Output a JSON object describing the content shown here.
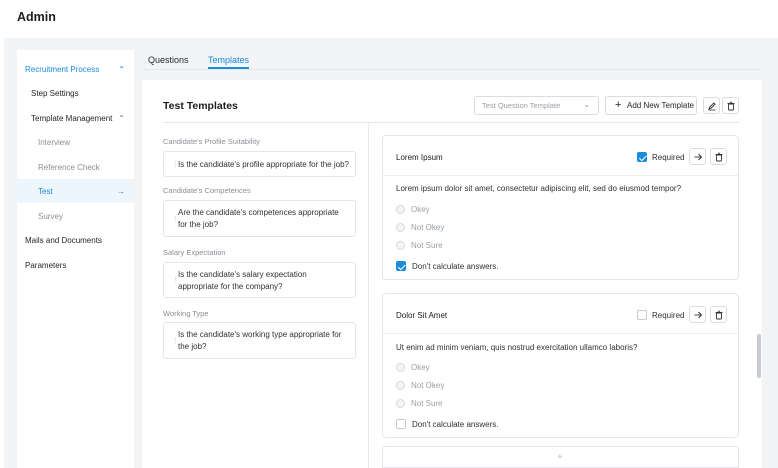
{
  "app": {
    "title": "Admin"
  },
  "sidebar": {
    "items": [
      {
        "label": "Recruitment Process",
        "chevron": "⌃"
      },
      {
        "label": "Step Settings"
      },
      {
        "label": "Template Management",
        "chevron": "⌃"
      },
      {
        "label": "Interview"
      },
      {
        "label": "Reference Check"
      },
      {
        "label": "Test",
        "chevron": "→"
      },
      {
        "label": "Survey"
      },
      {
        "label": "Mails and Documents"
      },
      {
        "label": "Parameters"
      }
    ]
  },
  "tabs": [
    {
      "label": "Questions"
    },
    {
      "label": "Templates"
    }
  ],
  "panel": {
    "title": "Test Templates",
    "select_placeholder": "Test Question Template",
    "add_button": "Add New Template"
  },
  "questions": [
    {
      "category": "Candidate's Profile Suitability",
      "text": "Is the candidate's profile appropriate for the job?"
    },
    {
      "category": "Candidate's Competences",
      "text": "Are the candidate's competences appropriate for the job?"
    },
    {
      "category": "Salary Expectation",
      "text": "Is the candidate's salary expectation appropriate for the company?"
    },
    {
      "category": "Working Type",
      "text": "Is the candidate's working type appropriate for the job?"
    }
  ],
  "cards": [
    {
      "title": "Lorem Ipsum",
      "required_label": "Required",
      "required": true,
      "question": "Lorem ipsum dolor sit amet, consectetur adipiscing elit, sed do eiusmod tempor?",
      "options": [
        "Okey",
        "Not Okey",
        "Not Sure"
      ],
      "dont_calc_label": "Don't calculate answers.",
      "dont_calc": true
    },
    {
      "title": "Dolor Sit Amet",
      "required_label": "Required",
      "required": false,
      "question": "Ut enim ad minim veniam, quis nostrud exercitation ullamco laboris?",
      "options": [
        "Okey",
        "Not Okey",
        "Not Sure"
      ],
      "dont_calc_label": "Don't calculate answers.",
      "dont_calc": false
    }
  ],
  "add_card": {
    "label": "+"
  },
  "colors": {
    "accent": "#1a8cdd",
    "background": "#f3f4f6",
    "border": "#e4e6ea"
  }
}
